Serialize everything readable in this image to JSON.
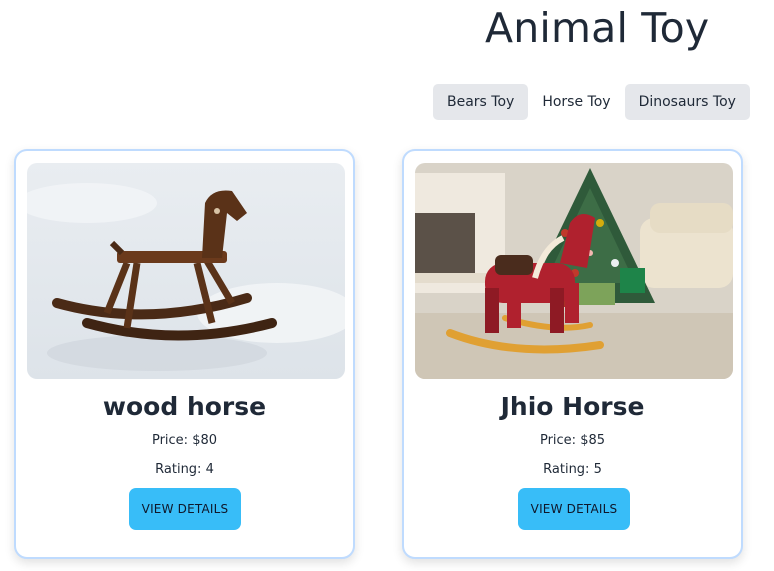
{
  "page": {
    "title": "Animal Toy"
  },
  "tabs": [
    {
      "label": "Bears Toy",
      "active": false
    },
    {
      "label": "Horse Toy",
      "active": true
    },
    {
      "label": "Dinosaurs Toy",
      "active": false
    }
  ],
  "products": [
    {
      "name": "wood horse",
      "price": "Price: $80",
      "rating": "Rating: 4",
      "button_label": "VIEW DETAILS"
    },
    {
      "name": "Jhio Horse",
      "price": "Price: $85",
      "rating": "Rating: 5",
      "button_label": "VIEW DETAILS"
    }
  ],
  "colors": {
    "button_bg": "#38bdf8",
    "tab_inactive_bg": "#e5e7eb",
    "card_border": "#bfdbfe"
  }
}
